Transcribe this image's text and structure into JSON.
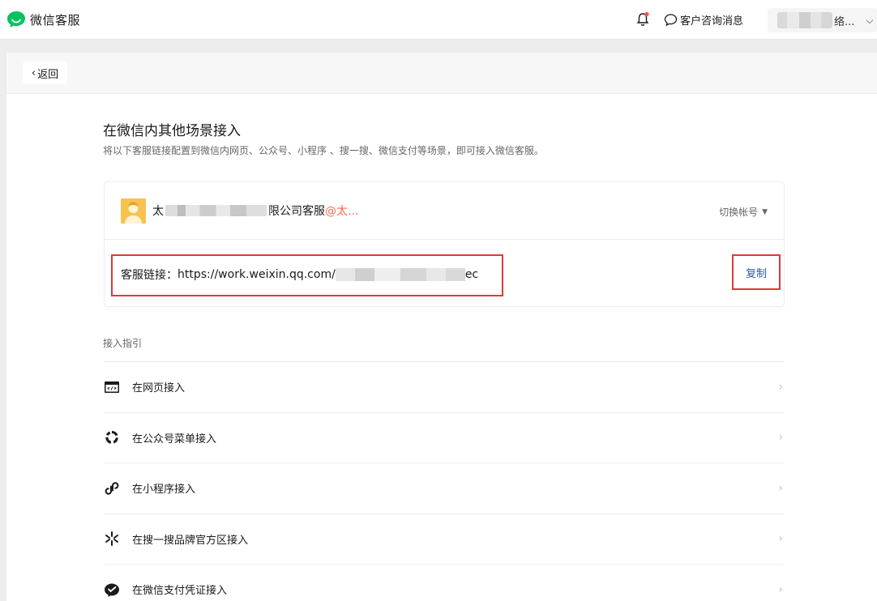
{
  "header": {
    "app_name": "微信客服",
    "consult_label": "客户咨询消息",
    "account_suffix": "络...",
    "account_chevron": "⌄"
  },
  "panel": {
    "back_label": "返回",
    "title": "在微信内其他场景接入",
    "subtitle": "将以下客服链接配置到微信内网页、公众号、小程序 、搜一搜、微信支付等场景，即可接入微信客服。"
  },
  "card": {
    "kf_name_prefix": "太",
    "kf_name_suffix": "限公司客服",
    "kf_at": "@太...",
    "switch_label": "切换帐号",
    "link_label": "客服链接：",
    "link_url_start": "https://work.weixin.qq.com/",
    "link_url_end": "ec",
    "copy_label": "复制"
  },
  "guide": {
    "title": "接入指引",
    "items": [
      {
        "label": "在网页接入",
        "icon": "webpage-icon"
      },
      {
        "label": "在公众号菜单接入",
        "icon": "official-account-icon"
      },
      {
        "label": "在小程序接入",
        "icon": "mini-program-icon"
      },
      {
        "label": "在搜一搜品牌官方区接入",
        "icon": "search-sparkle-icon"
      },
      {
        "label": "在微信支付凭证接入",
        "icon": "wechat-pay-icon"
      }
    ]
  },
  "colors": {
    "brand_green": "#07c160",
    "highlight_red": "#e03838",
    "link_blue": "#2c5aa8",
    "at_orange": "#fa6a4e"
  }
}
